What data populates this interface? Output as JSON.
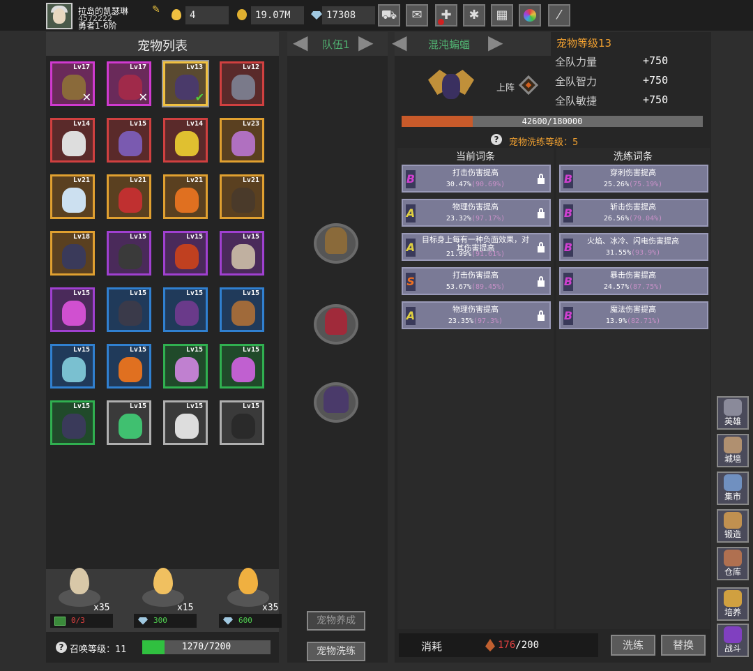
{
  "player": {
    "name": "拉岛的凯瑟琳",
    "id": "4572222",
    "rank": "勇者1-6阶"
  },
  "resources": {
    "eggs": "4",
    "gold": "19.07M",
    "gems": "17308"
  },
  "toolbar_icons": [
    "cart-icon",
    "mail-icon",
    "gamepad-icon",
    "gear-icon",
    "gift-icon",
    "colorwheel-icon",
    "feather-icon"
  ],
  "pet_list": {
    "title": "宠物列表",
    "cells": [
      {
        "lv": "Lv17",
        "rarity": "mag",
        "color": "#8a6a3a",
        "mark": "✕"
      },
      {
        "lv": "Lv17",
        "rarity": "mag",
        "color": "#a02a4a",
        "mark": "✕"
      },
      {
        "lv": "Lv13",
        "rarity": "sel",
        "color": "#4a3a6a",
        "mark": "✔"
      },
      {
        "lv": "Lv12",
        "rarity": "red",
        "color": "#7a7a8a",
        "mark": ""
      },
      {
        "lv": "Lv14",
        "rarity": "red",
        "color": "#ddd",
        "mark": ""
      },
      {
        "lv": "Lv15",
        "rarity": "red",
        "color": "#7a5ab0",
        "mark": ""
      },
      {
        "lv": "Lv14",
        "rarity": "red",
        "color": "#e0c030",
        "mark": ""
      },
      {
        "lv": "Lv23",
        "rarity": "gold",
        "color": "#b070c0",
        "mark": ""
      },
      {
        "lv": "Lv21",
        "rarity": "gold",
        "color": "#cce0f0",
        "mark": ""
      },
      {
        "lv": "Lv21",
        "rarity": "gold",
        "color": "#c03030",
        "mark": ""
      },
      {
        "lv": "Lv21",
        "rarity": "gold",
        "color": "#e07020",
        "mark": ""
      },
      {
        "lv": "Lv21",
        "rarity": "gold",
        "color": "#4a3a2a",
        "mark": ""
      },
      {
        "lv": "Lv18",
        "rarity": "gold",
        "color": "#3a3a5a",
        "mark": ""
      },
      {
        "lv": "Lv15",
        "rarity": "pur",
        "color": "#3a3a3a",
        "mark": ""
      },
      {
        "lv": "Lv15",
        "rarity": "pur",
        "color": "#c04020",
        "mark": ""
      },
      {
        "lv": "Lv15",
        "rarity": "pur",
        "color": "#c0b0a0",
        "mark": ""
      },
      {
        "lv": "Lv15",
        "rarity": "pur",
        "color": "#d050d0",
        "mark": ""
      },
      {
        "lv": "Lv15",
        "rarity": "blue",
        "color": "#3a3a4a",
        "mark": ""
      },
      {
        "lv": "Lv15",
        "rarity": "blue",
        "color": "#6a3a8a",
        "mark": ""
      },
      {
        "lv": "Lv15",
        "rarity": "blue",
        "color": "#a06a3a",
        "mark": ""
      },
      {
        "lv": "Lv15",
        "rarity": "blue",
        "color": "#7ac0d0",
        "mark": ""
      },
      {
        "lv": "Lv15",
        "rarity": "blue",
        "color": "#e07020",
        "mark": ""
      },
      {
        "lv": "Lv15",
        "rarity": "green",
        "color": "#c080d0",
        "mark": ""
      },
      {
        "lv": "Lv15",
        "rarity": "green",
        "color": "#c060d0",
        "mark": ""
      },
      {
        "lv": "Lv15",
        "rarity": "green",
        "color": "#3a3a5a",
        "mark": ""
      },
      {
        "lv": "Lv15",
        "rarity": "white",
        "color": "#40c070",
        "mark": ""
      },
      {
        "lv": "Lv15",
        "rarity": "white",
        "color": "#ddd",
        "mark": ""
      },
      {
        "lv": "Lv15",
        "rarity": "white",
        "color": "#2a2a2a",
        "mark": ""
      }
    ]
  },
  "eggs": [
    {
      "count": "x35",
      "cost_label": "0/3",
      "cost_icon": "video-icon",
      "egg_color": "#d8c8a8"
    },
    {
      "count": "x15",
      "cost_label": "300",
      "cost_icon": "diamond-icon",
      "egg_color": "#f0c060"
    },
    {
      "count": "x35",
      "cost_label": "600",
      "cost_icon": "diamond-icon",
      "egg_color": "#f0b040"
    }
  ],
  "summon": {
    "label": "召唤等级：",
    "level": "11",
    "progress_text": "1270/7200",
    "progress": 0.176
  },
  "team": {
    "label": "队伍1",
    "btn_raise": "宠物养成",
    "btn_refine": "宠物洗练"
  },
  "pet_detail": {
    "name": "混沌蝙蝠",
    "level_label": "宠物等级13",
    "deploy_label": "上阵",
    "stats": [
      {
        "name": "全队力量",
        "value": "+750"
      },
      {
        "name": "全队智力",
        "value": "+750"
      },
      {
        "name": "全队敏捷",
        "value": "+750"
      }
    ],
    "exp_text": "42600/180000",
    "exp_progress": 0.237,
    "refine_level_label": "宠物洗练等级：",
    "refine_level": "5"
  },
  "affix": {
    "current_header": "当前词条",
    "refine_header": "洗练词条",
    "current": [
      {
        "grade": "B",
        "name": "打击伤害提高",
        "value": "30.47%",
        "max": "(90.69%)",
        "gc": "#d040d0"
      },
      {
        "grade": "A",
        "name": "物理伤害提高",
        "value": "23.32%",
        "max": "(97.17%)",
        "gc": "#e0d040"
      },
      {
        "grade": "A",
        "name": "目标身上每有一种负面效果，对其伤害提高",
        "value": "21.99%",
        "max": "(91.61%)",
        "gc": "#e0d040"
      },
      {
        "grade": "S",
        "name": "打击伤害提高",
        "value": "53.67%",
        "max": "(89.45%)",
        "gc": "#f07020"
      },
      {
        "grade": "A",
        "name": "物理伤害提高",
        "value": "23.35%",
        "max": "(97.3%)",
        "gc": "#e0d040"
      }
    ],
    "refine": [
      {
        "grade": "B",
        "name": "穿刺伤害提高",
        "value": "25.26%",
        "max": "(75.19%)",
        "gc": "#d040d0"
      },
      {
        "grade": "B",
        "name": "斩击伤害提高",
        "value": "26.56%",
        "max": "(79.04%)",
        "gc": "#d040d0"
      },
      {
        "grade": "B",
        "name": "火焰、冰冷、闪电伤害提高",
        "value": "31.55%",
        "max": "(93.9%)",
        "gc": "#d040d0"
      },
      {
        "grade": "B",
        "name": "暴击伤害提高",
        "value": "24.57%",
        "max": "(87.75%)",
        "gc": "#d040d0"
      },
      {
        "grade": "B",
        "name": "魔法伤害提高",
        "value": "13.9%",
        "max": "(82.71%)",
        "gc": "#d040d0"
      }
    ]
  },
  "cost": {
    "label": "消耗",
    "current": "176",
    "total": "/200",
    "btn_refine": "洗练",
    "btn_replace": "替换"
  },
  "sidebar": [
    {
      "label": "英雄",
      "color": "#8a8a9a"
    },
    {
      "label": "城墙",
      "color": "#b09070"
    },
    {
      "label": "集市",
      "color": "#7090c0"
    },
    {
      "label": "锻造",
      "color": "#c09050"
    },
    {
      "label": "仓库",
      "color": "#b07050"
    },
    {
      "label": "培养",
      "color": "#d0a040"
    },
    {
      "label": "战斗",
      "color": "#8040c0"
    }
  ]
}
